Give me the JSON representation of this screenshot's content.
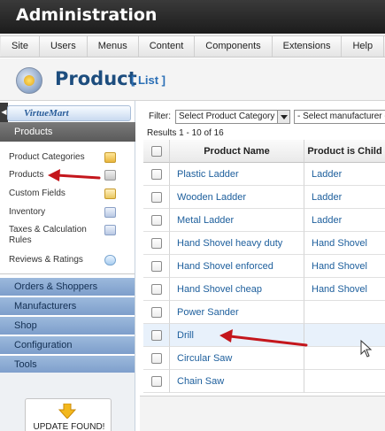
{
  "app": {
    "title": "Administration"
  },
  "menubar": [
    "Site",
    "Users",
    "Menus",
    "Content",
    "Components",
    "Extensions",
    "Help"
  ],
  "page": {
    "title": "Product",
    "subtitle": "[ List ]"
  },
  "sidebar": {
    "logo_text": "VirtueMart",
    "section_header": "Products",
    "items": [
      {
        "label": "Product Categories",
        "icon": "folder-icon"
      },
      {
        "label": "Products",
        "icon": "product-icon"
      },
      {
        "label": "Custom Fields",
        "icon": "custom-fields-icon"
      },
      {
        "label": "Inventory",
        "icon": "inventory-icon"
      },
      {
        "label": "Taxes & Calculation Rules",
        "icon": "calculator-icon"
      },
      {
        "label": "Reviews & Ratings",
        "icon": "chat-bubble-icon"
      }
    ],
    "sections": [
      "Orders & Shoppers",
      "Manufacturers",
      "Shop",
      "Configuration",
      "Tools"
    ],
    "update": {
      "label": "UPDATE FOUND!",
      "icon": "down-arrow-icon"
    }
  },
  "filter": {
    "label": "Filter:",
    "category_select": "Select Product Category",
    "manufacturer_select": "- Select manufacturer -"
  },
  "results": "Results 1 - 10 of 16",
  "table": {
    "headers": [
      "",
      "Product Name",
      "Product is Child"
    ],
    "rows": [
      {
        "name": "Plastic Ladder",
        "parent": "Ladder"
      },
      {
        "name": "Wooden Ladder",
        "parent": "Ladder"
      },
      {
        "name": "Metal Ladder",
        "parent": "Ladder"
      },
      {
        "name": "Hand Shovel heavy duty",
        "parent": "Hand Shovel"
      },
      {
        "name": "Hand Shovel enforced",
        "parent": "Hand Shovel"
      },
      {
        "name": "Hand Shovel cheap",
        "parent": "Hand Shovel"
      },
      {
        "name": "Power Sander",
        "parent": ""
      },
      {
        "name": "Drill",
        "parent": ""
      },
      {
        "name": "Circular Saw",
        "parent": ""
      },
      {
        "name": "Chain Saw",
        "parent": ""
      }
    ]
  },
  "colors": {
    "header_bg": "#262626",
    "accent_blue": "#1d4d7e",
    "link_blue": "#1c5e9c",
    "sidebar_section": "#8eadd5",
    "annotation_arrow": "#c4161c"
  }
}
